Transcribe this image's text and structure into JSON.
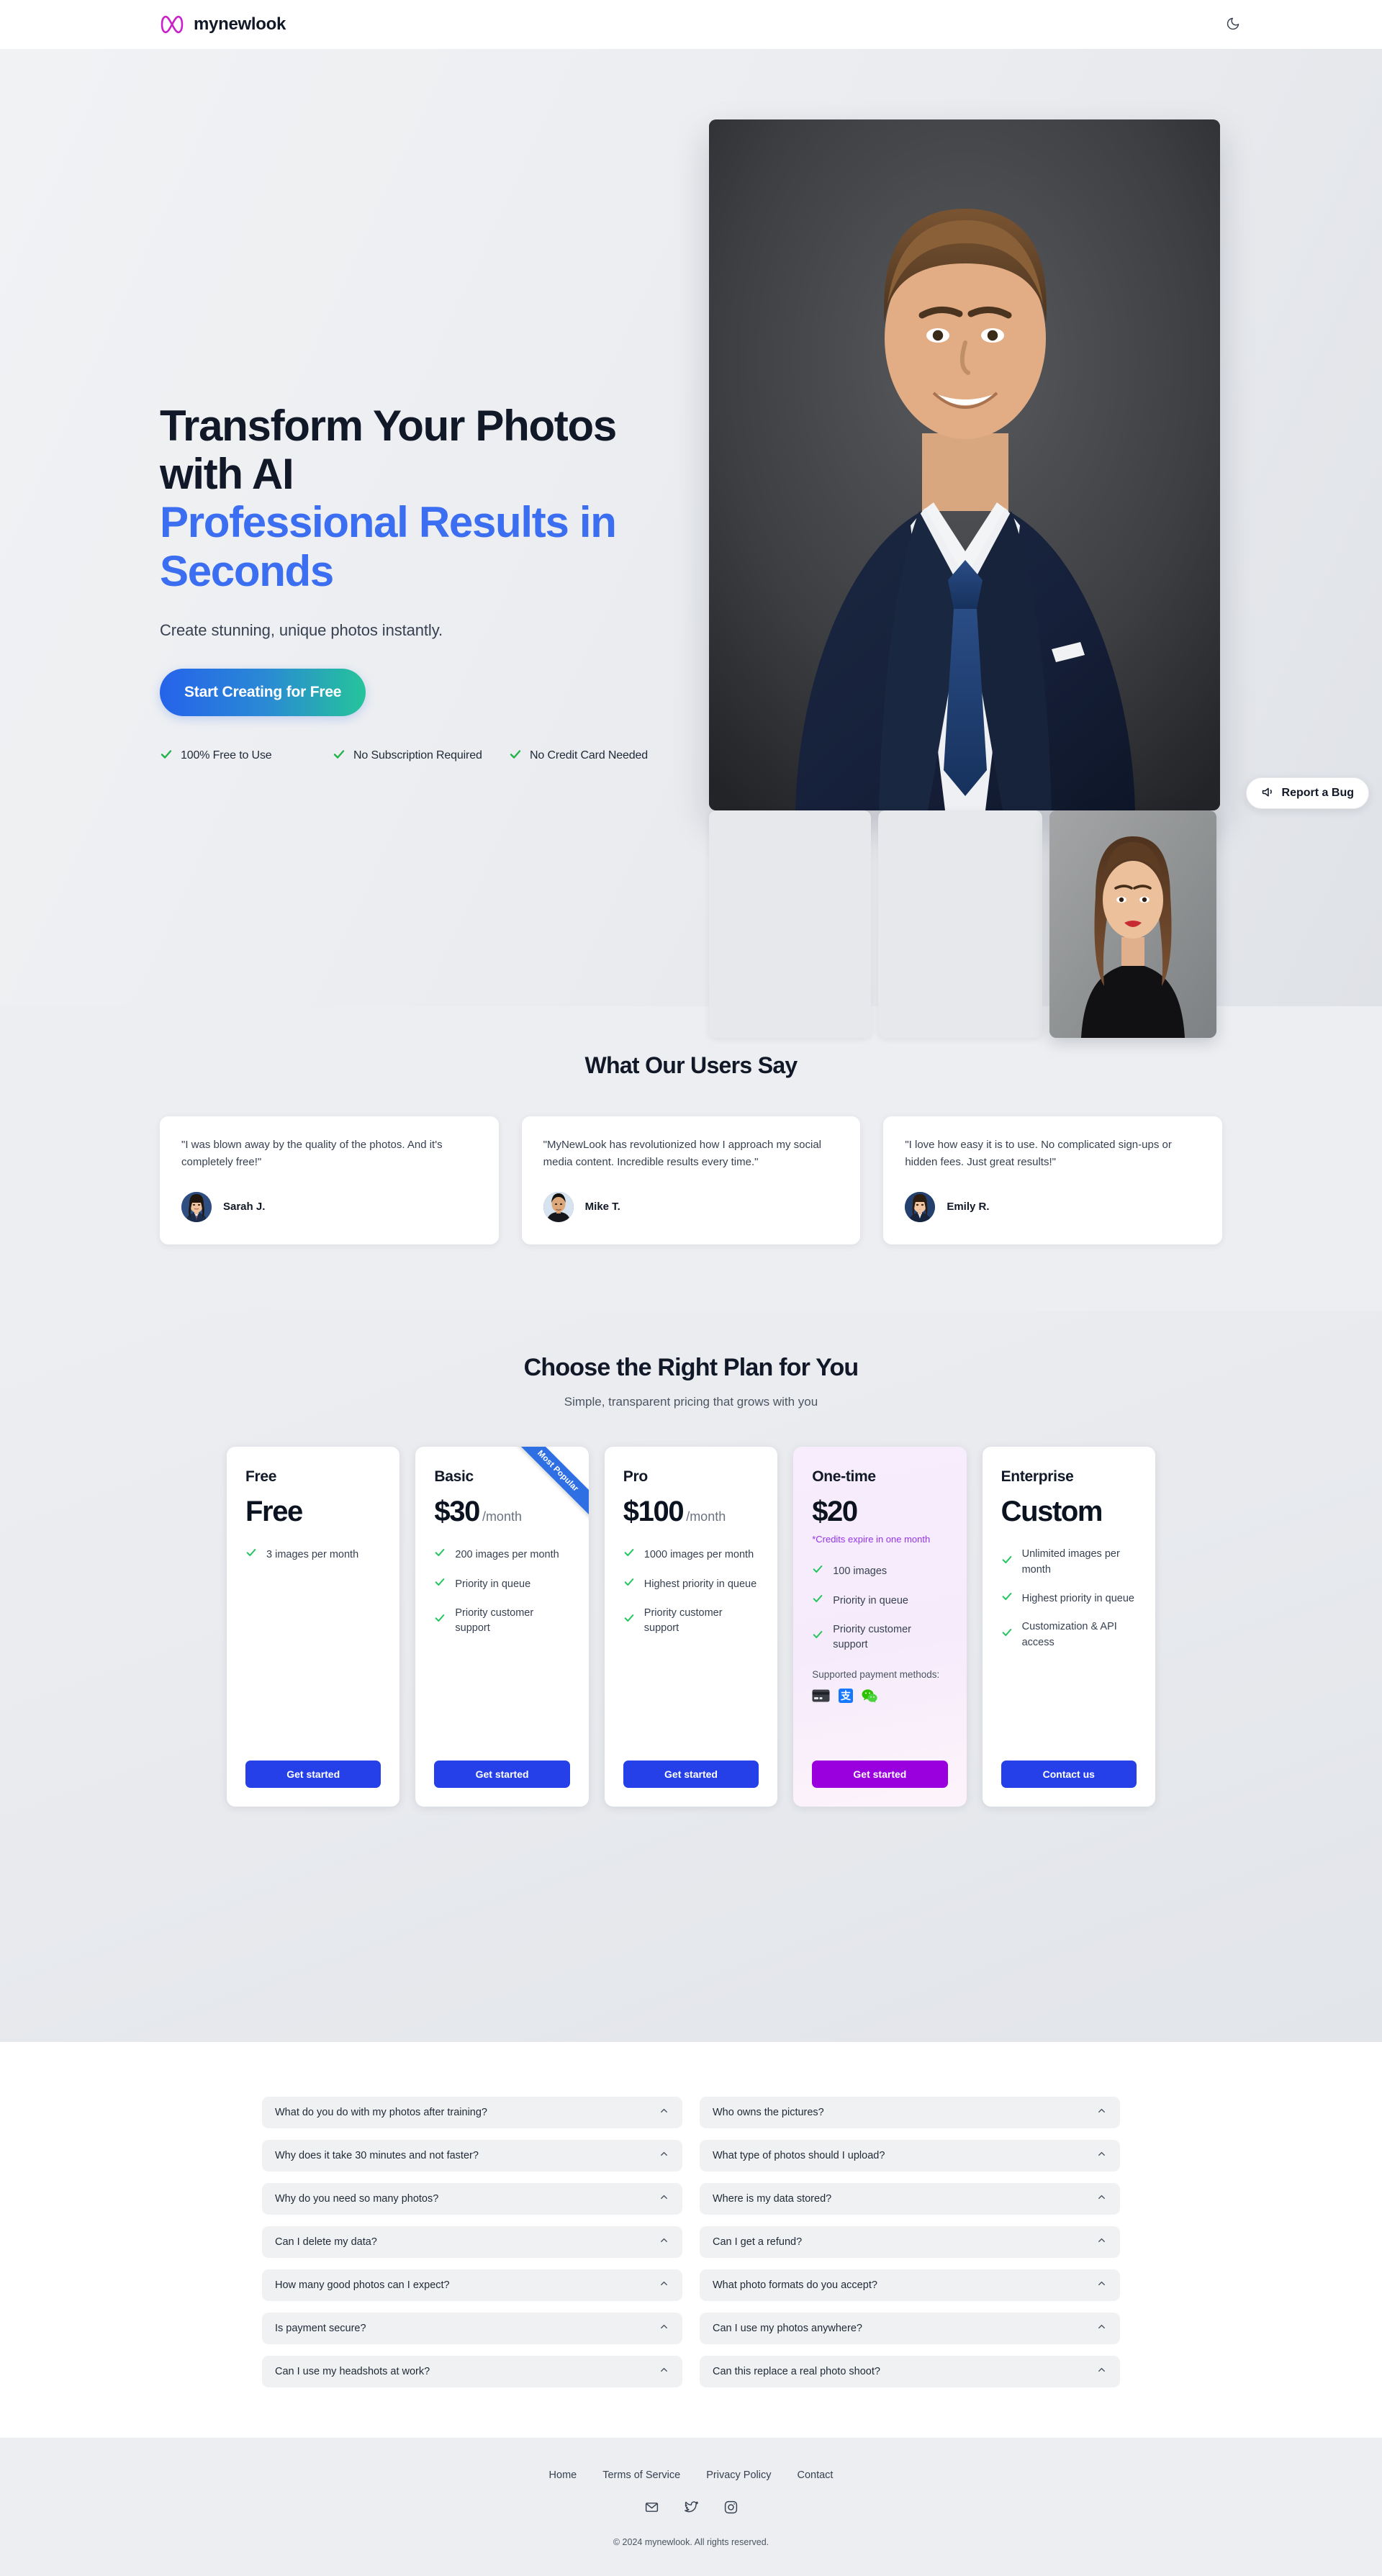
{
  "header": {
    "brand_name": "mynewlook",
    "logo_icon": "infinity-icon",
    "logo_color": "#c920c9",
    "theme_toggle_icon": "moon-icon"
  },
  "hero": {
    "title_line1": "Transform Your Photos",
    "title_line2": "with AI",
    "title_accent": "Professional Results in Seconds",
    "subtitle": "Create stunning, unique photos instantly.",
    "cta_label": "Start Creating for Free",
    "cta_gradient_from": "#2563eb",
    "cta_gradient_to": "#25c49a",
    "features": [
      {
        "icon": "check-icon",
        "label": "100% Free to Use"
      },
      {
        "icon": "check-icon",
        "label": "No Subscription Required"
      },
      {
        "icon": "check-icon",
        "label": "No Credit Card Needed"
      }
    ],
    "accent_color": "#3b6ef0"
  },
  "report_bug": {
    "label": "Report a Bug",
    "icon": "megaphone-icon"
  },
  "testimonials": {
    "title": "What Our Users Say",
    "cards": [
      {
        "quote": "\"I was blown away by the quality of the photos. And it's completely free!\"",
        "name": "Sarah J.",
        "avatar": "avatar-sarah"
      },
      {
        "quote": "\"MyNewLook has revolutionized how I approach my social media content. Incredible results every time.\"",
        "name": "Mike T.",
        "avatar": "avatar-mike"
      },
      {
        "quote": "\"I love how easy it is to use. No complicated sign-ups or hidden fees. Just great results!\"",
        "name": "Emily R.",
        "avatar": "avatar-emily"
      }
    ]
  },
  "pricing": {
    "title": "Choose the Right Plan for You",
    "subtitle": "Simple, transparent pricing that grows with you",
    "ribbon_label": "Most Popular",
    "plans": [
      {
        "name": "Free",
        "price": "Free",
        "period": "",
        "note": "",
        "features": [
          "3 images per month"
        ],
        "button_label": "Get started",
        "button_color": "#2540e8",
        "featured": false,
        "ribbon": false
      },
      {
        "name": "Basic",
        "price": "$30",
        "period": "/month",
        "note": "",
        "features": [
          "200 images per month",
          "Priority in queue",
          "Priority customer support"
        ],
        "button_label": "Get started",
        "button_color": "#2540e8",
        "featured": false,
        "ribbon": true
      },
      {
        "name": "Pro",
        "price": "$100",
        "period": "/month",
        "note": "",
        "features": [
          "1000 images per month",
          "Highest priority in queue",
          "Priority customer support"
        ],
        "button_label": "Get started",
        "button_color": "#2540e8",
        "featured": false,
        "ribbon": false
      },
      {
        "name": "One-time",
        "price": "$20",
        "period": "",
        "note": "*Credits expire in one month",
        "features": [
          "100 images",
          "Priority in queue",
          "Priority customer support"
        ],
        "payment_label": "Supported payment methods:",
        "payment_icons": [
          "credit-card-icon",
          "alipay-icon",
          "wechat-pay-icon"
        ],
        "button_label": "Get started",
        "button_color": "#9900dd",
        "featured": true,
        "ribbon": false
      },
      {
        "name": "Enterprise",
        "price": "Custom",
        "period": "",
        "note": "",
        "features": [
          "Unlimited images per month",
          "Highest priority in queue",
          "Customization & API access"
        ],
        "button_label": "Contact us",
        "button_color": "#2540e8",
        "featured": false,
        "ribbon": false
      }
    ]
  },
  "faq": {
    "items": [
      {
        "question": "What do you do with my photos after training?",
        "icon": "chevron-up-icon"
      },
      {
        "question": "Who owns the pictures?",
        "icon": "chevron-up-icon"
      },
      {
        "question": "Why does it take 30 minutes and not faster?",
        "icon": "chevron-up-icon"
      },
      {
        "question": "What type of photos should I upload?",
        "icon": "chevron-up-icon"
      },
      {
        "question": "Why do you need so many photos?",
        "icon": "chevron-up-icon"
      },
      {
        "question": "Where is my data stored?",
        "icon": "chevron-up-icon"
      },
      {
        "question": "Can I delete my data?",
        "icon": "chevron-up-icon"
      },
      {
        "question": "Can I get a refund?",
        "icon": "chevron-up-icon"
      },
      {
        "question": "How many good photos can I expect?",
        "icon": "chevron-up-icon"
      },
      {
        "question": "What photo formats do you accept?",
        "icon": "chevron-up-icon"
      },
      {
        "question": "Is payment secure?",
        "icon": "chevron-up-icon"
      },
      {
        "question": "Can I use my photos anywhere?",
        "icon": "chevron-up-icon"
      },
      {
        "question": "Can I use my headshots at work?",
        "icon": "chevron-up-icon"
      },
      {
        "question": "Can this replace a real photo shoot?",
        "icon": "chevron-up-icon"
      }
    ]
  },
  "footer": {
    "links": [
      "Home",
      "Terms of Service",
      "Privacy Policy",
      "Contact"
    ],
    "social": [
      "email-icon",
      "twitter-icon",
      "instagram-icon"
    ],
    "copyright": "© 2024 mynewlook. All rights reserved."
  }
}
